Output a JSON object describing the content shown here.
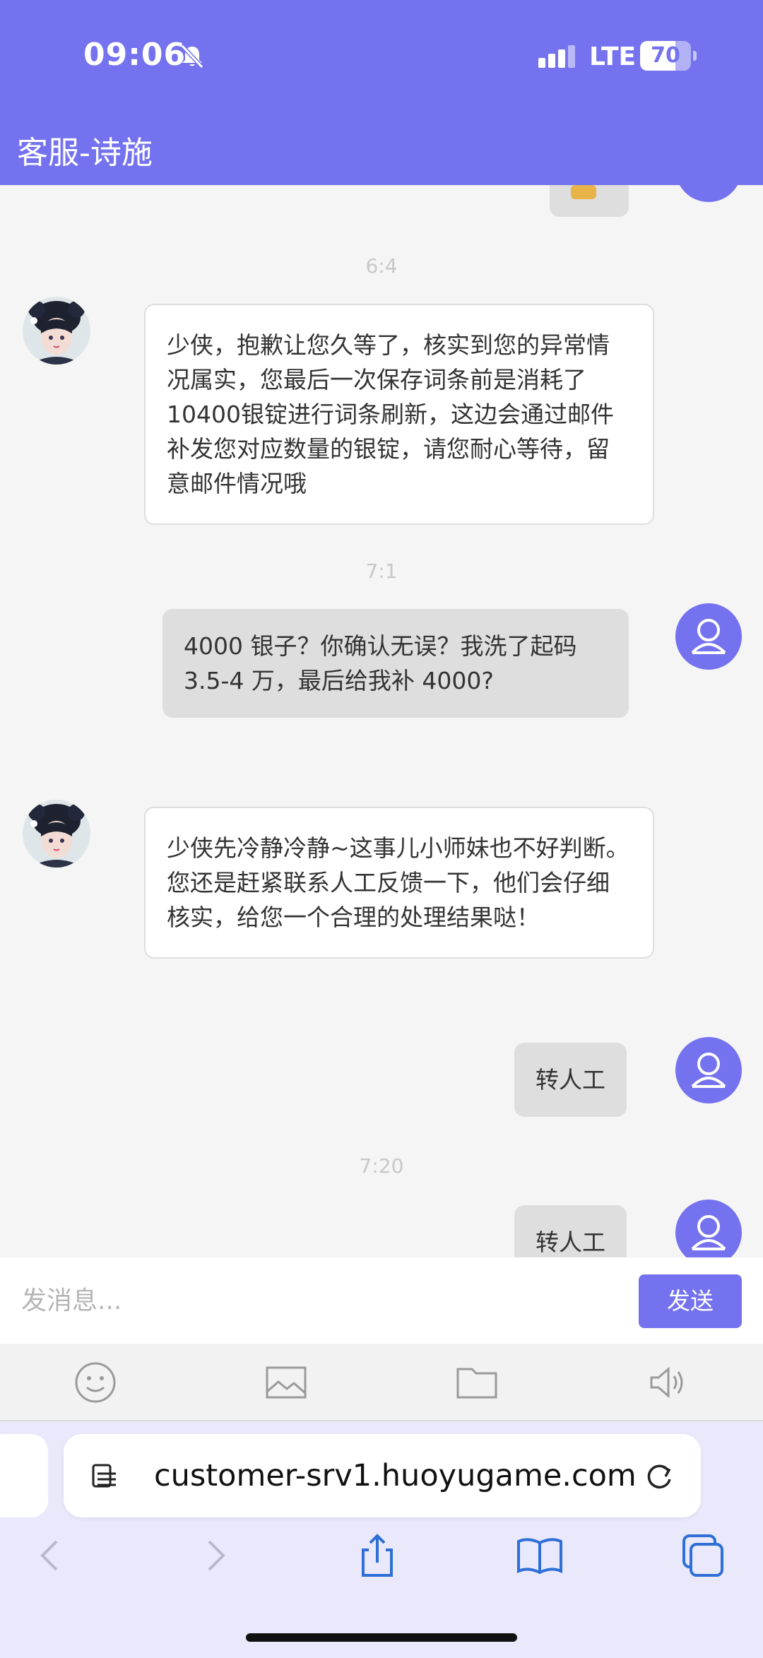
{
  "status_bar": {
    "time": "09:06",
    "network": "LTE",
    "battery_level": "70",
    "battery_fraction": 0.7
  },
  "header": {
    "title": "客服-诗施"
  },
  "messages": {
    "time_1": "6:4",
    "bot_1": "少侠，抱歉让您久等了，核实到您的异常情况属实，您最后一次保存词条前是消耗了10400银锭进行词条刷新，这边会通过邮件补发您对应数量的银锭，请您耐心等待，留意邮件情况哦",
    "time_2": "7:1",
    "user_1": "4000 银子？你确认无误？我洗了起码 3.5-4 万，最后给我补 4000?",
    "bot_2": "少侠先冷静冷静~这事儿小师妹也不好判断。您还是赶紧联系人工反馈一下，他们会仔细核实，给您一个合理的处理结果哒！",
    "user_2": "转人工",
    "time_3": "7:20",
    "user_3": "转人工"
  },
  "input": {
    "placeholder": "发消息...",
    "send_label": "发送"
  },
  "browser": {
    "url": "customer-srv1.huoyugame.com"
  },
  "colors": {
    "accent": "#7472ee",
    "user_bubble": "#dedede",
    "bot_bubble": "#ffffff",
    "background": "#f5f5f5"
  },
  "icons": [
    "bell-slash-icon",
    "signal-icon",
    "battery-icon",
    "user-avatar-icon",
    "emoji-icon",
    "image-icon",
    "folder-icon",
    "volume-icon",
    "page-menu-icon",
    "reload-icon",
    "back-icon",
    "forward-icon",
    "share-icon",
    "bookmarks-icon",
    "tabs-icon"
  ]
}
